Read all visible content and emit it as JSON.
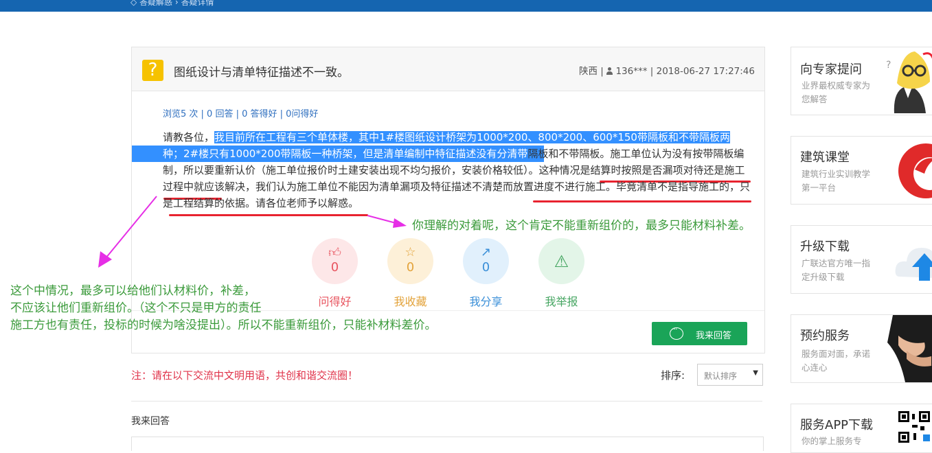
{
  "breadcrumb": "◇ 答疑解惑 › 答疑详情",
  "question": {
    "title": "图纸设计与清单特征描述不一致。",
    "region": "陕西",
    "user": "136***",
    "datetime": "2018-06-27 17:27:46",
    "stats": "浏览5 次 | 0 回答 | 0 答得好 | 0问得好",
    "body_prefix": "请教各位，",
    "body_highlight_1": "我目前所在工程有三个单体楼，其中1#楼图纸设计桥架为1000*200、800*200、600*150带隔板和不带隔板两",
    "body_highlight_2": "种；2#楼只有1000*200带隔板一种桥架，但是清单编制中特征描述没有分清带",
    "body_rest": "隔板和不带隔板。施工单位认为没有按带隔板编制，所以要重新认价（施工单位报价时土建安装出现不均匀报价，安装价格较低）。这种情况是结算时按照是否漏项对待还是施工过程中就应该解决，我们认为施工单位不能因为清单漏项及特征描述不清楚而放置进度不进行施工。毕竟清单不是指导施工的，只是工程结算的依据。请各位老师予以解惑。"
  },
  "actions": [
    {
      "name": "like",
      "label": "问得好",
      "count": "0",
      "icon": "thumbs-up-icon",
      "color": "#e8545f",
      "bg": "#fde7e8"
    },
    {
      "name": "collect",
      "label": "我收藏",
      "count": "0",
      "icon": "star-icon",
      "color": "#e3a33b",
      "bg": "#fdf0d8"
    },
    {
      "name": "share",
      "label": "我分享",
      "count": "0",
      "icon": "share-icon",
      "color": "#3a8fd8",
      "bg": "#e1f0fc"
    },
    {
      "name": "report",
      "label": "我举报",
      "count": "",
      "icon": "warning-icon",
      "color": "#45a561",
      "bg": "#e3f5e8"
    }
  ],
  "answer_button": "我来回答",
  "notice": "注：请在以下交流中文明用语，共创和谐交流圈！",
  "sort": {
    "label": "排序:",
    "value": "默认排序"
  },
  "my_answer_label": "我来回答",
  "sidebar": [
    {
      "title": "向专家提问",
      "desc": "业界最权威专家为您解答"
    },
    {
      "title": "建筑课堂",
      "desc": "建筑行业实训教学第一平台"
    },
    {
      "title": "升级下载",
      "desc": "广联达官方唯一指定升级下载"
    },
    {
      "title": "预约服务",
      "desc": "服务面对面，承诺心连心"
    },
    {
      "title": "服务APP下载",
      "desc": "你的掌上服务专"
    }
  ],
  "annotations": {
    "reply": "你理解的对着呢，这个肯定不能重新组价的，最多只能材料补差。",
    "note_line1": "这个中情况，最多可以给他们认材料价，补差，",
    "note_line2": "不应该让他们重新组价。（这个不只是甲方的责任",
    "note_line3": "施工方也有责任，投标的时候为啥没提出）。所以不能重新组价，只能补材料差价。"
  },
  "colors": {
    "topbar": "#1565b0",
    "highlight": "#3390ff",
    "annotation_green": "#3a9a3a",
    "arrow_magenta": "#e62ee6",
    "answer_button": "#1aa458"
  }
}
